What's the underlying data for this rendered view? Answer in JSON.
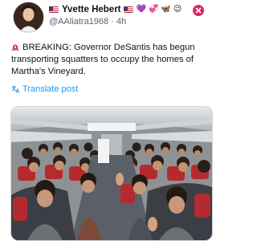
{
  "user": {
    "display_name": "Yvette Hebert",
    "handle": "@AAliatra1968",
    "time": "4h",
    "emojis": [
      "💜",
      "💞",
      "🦋",
      "😉"
    ]
  },
  "tweet": {
    "text": "BREAKING: Governor DeSantis has begun transporting squatters to occupy the homes of Martha's Vineyard.",
    "translate_label": "Translate post"
  },
  "icons": {
    "avatar": "avatar-image",
    "verified": "circle-x-badge",
    "siren": "rotating-light-icon",
    "translate": "translate-icon",
    "media": "photo-airplane-cabin-passengers"
  },
  "colors": {
    "link": "#1d9bf0",
    "text": "#0f1419",
    "secondary": "#536471",
    "badge": "#e0245e"
  }
}
